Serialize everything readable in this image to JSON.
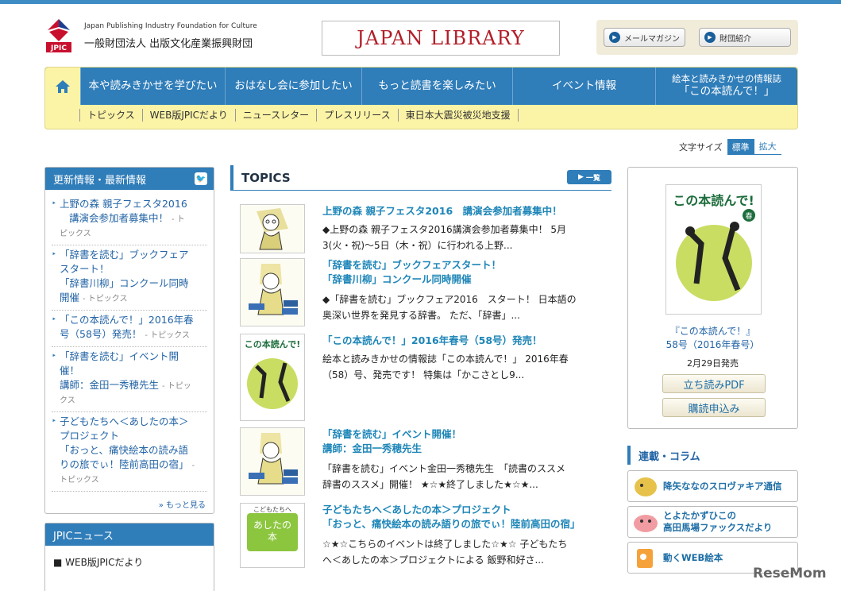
{
  "header": {
    "org_en": "Japan Publishing Industry Foundation for Culture",
    "org_jp": "一般財団法人 出版文化産業振興財団",
    "logo_text": "JPIC",
    "library_title": "JAPAN LIBRARY",
    "mail_btn": "メールマガジン",
    "about_btn": "財団紹介"
  },
  "nav": {
    "main": [
      "本や読みきかせを学びたい",
      "おはなし会に参加したい",
      "もっと読書を楽しみたい",
      "イベント情報"
    ],
    "special_line1": "絵本と読みきかせの情報誌",
    "special_line2": "「この本読んで！」",
    "sub": [
      "トピックス",
      "WEB版JPICだより",
      "ニュースレター",
      "プレスリリース",
      "東日本大震災被災地支援"
    ]
  },
  "font_size": {
    "label": "文字サイズ",
    "standard": "標準",
    "large": "拡大"
  },
  "news": {
    "title": "更新情報・最新情報",
    "items": [
      {
        "l1": "上野の森 親子フェスタ2016",
        "l2": "講演会参加者募集中！",
        "cat": "- ト",
        "cat2": "ピックス"
      },
      {
        "l1": "「辞書を読む」ブックフェア",
        "l2": "スタート！",
        "l3": "「辞書川柳」コンクール同時",
        "l4": "開催",
        "cat": "- トピックス"
      },
      {
        "l1": "「この本読んで！」2016年春",
        "l2": "号（58号）発売！",
        "cat": "- トピックス"
      },
      {
        "l1": "「辞書を読む」イベント開",
        "l2": "催！",
        "l3": "講師：金田一秀穂先生",
        "cat": "- トピッ",
        "cat2": "クス"
      },
      {
        "l1": "子どもたちへ＜あしたの本＞",
        "l2": "プロジェクト",
        "l3": "「おっと、痛快絵本の読み語",
        "l4": "りの旅でぃ！陸前高田の宿」",
        "cat": "-",
        "cat2": "トピックス"
      }
    ],
    "more": "» もっと見る"
  },
  "jpic_news": {
    "title": "JPICニュース",
    "item": "■ WEB版JPICだより"
  },
  "topics": {
    "heading": "TOPICS",
    "list_btn": "一覧",
    "items": [
      {
        "title1": "上野の森 親子フェスタ2016　講演会参加者募集中！",
        "body1": "◆上野の森 親子フェスタ2016講演会参加者募集中！ 5月",
        "body2": "3(火・祝)～5日（木・祝）に行われる上野..."
      },
      {
        "title1": "「辞書を読む」ブックフェアスタート！",
        "title2": "「辞書川柳」コンクール同時開催",
        "body1": "◆「辞書を読む」ブックフェア2016　スタート！ 日本語の",
        "body2": "奥深い世界を発見する辞書。 ただ、「辞書」..."
      },
      {
        "title1": "「この本読んで！」2016年春号（58号）発売！",
        "body1": "絵本と読みきかせの情報誌「この本読んで！」 2016年春",
        "body2": "（58）号、発売です！ 特集は「かこさとし9..."
      },
      {
        "title1": "「辞書を読む」イベント開催！",
        "title2": "講師：金田一秀穂先生",
        "body1": "「辞書を読む」イベント金田一秀穂先生　「読書のススメ",
        "body2": "辞書のススメ」開催！ ★☆★終了しました★☆★..."
      },
      {
        "title1": "子どもたちへ＜あしたの本＞プロジェクト",
        "title2": "「おっと、痛快絵本の読み語りの旅でぃ！陸前高田の宿」",
        "body1": "☆★☆こちらのイベントは終了しました☆★☆ 子どもたち",
        "body2": "へ＜あしたの本＞プロジェクトによる 飯野和好さ..."
      }
    ],
    "thumb_cover_title": "この本読んで!",
    "thumb_ashita_top": "こどもたちへ",
    "thumb_ashita_main": "あしたの",
    "thumb_ashita_sub": "本"
  },
  "magazine": {
    "cover_title": "この本読んで!",
    "cover_season": "春",
    "caption1": "『この本読んで！』",
    "caption2": "58号（2016年春号）",
    "date": "2月29日発売",
    "pdf_btn": "立ち読みPDF",
    "subscribe_btn": "購読申込み"
  },
  "column": {
    "heading": "連載・コラム",
    "items": [
      {
        "l1": "降矢ななのスロヴァキア通信"
      },
      {
        "l1": "とよたかずひこの",
        "l2": "高田馬場ファックスだより"
      },
      {
        "l1": "動くWEB絵本"
      }
    ]
  },
  "watermark": "ReseMom"
}
